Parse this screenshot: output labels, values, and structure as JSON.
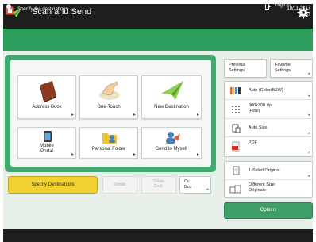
{
  "header": {
    "title": "Scan and Send",
    "title_icon": "scan-send-icon",
    "settings_icon": "gear-icon"
  },
  "message": {
    "text": "Specify the destinations.",
    "date": "10/11 2017",
    "time": "18:57"
  },
  "destinations": {
    "tiles": [
      {
        "label": "Address Book",
        "icon": "address-book-icon"
      },
      {
        "label": "One-Touch",
        "icon": "one-touch-icon"
      },
      {
        "label": "New Destination",
        "icon": "new-destination-icon"
      },
      {
        "label": "Mobile\nPortal",
        "icon": "mobile-portal-icon"
      },
      {
        "label": "Personal Folder",
        "icon": "personal-folder-icon"
      },
      {
        "label": "Send to Myself",
        "icon": "send-to-myself-icon"
      }
    ],
    "specify_label": "Specify Destinations",
    "details_label": "Details",
    "delete_label": "Delete\nDest.",
    "ccbcc_label": "Cc\nBcc"
  },
  "quick": {
    "previous_label": "Previous\nSettings",
    "favorite_label": "Favorite\nSettings"
  },
  "settings": {
    "items": [
      {
        "label": "Auto (Color/B&W)",
        "icon": "color-mode-icon"
      },
      {
        "label": "300x300 dpi\n(Fine)",
        "icon": "resolution-icon"
      },
      {
        "label": "Auto Size",
        "icon": "scan-size-icon"
      },
      {
        "label": "PDF",
        "icon": "file-format-icon"
      }
    ],
    "finishing": [
      {
        "label": "1-Sided Original",
        "icon": "original-sides-icon"
      },
      {
        "label": "Different Size\nOriginals",
        "icon": "different-size-originals-icon"
      }
    ],
    "options_label": "Options"
  },
  "footer": {
    "logout_label": "Log Out"
  },
  "colors": {
    "accent_green": "#42aa70",
    "specify_yellow": "#f2d230",
    "bar_dark": "#1e1e1e"
  }
}
